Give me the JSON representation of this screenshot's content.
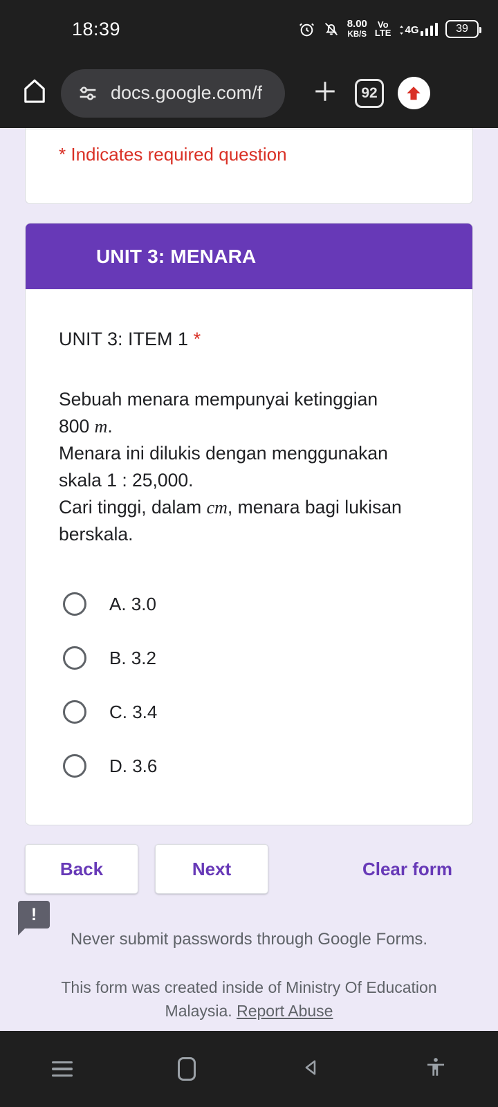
{
  "status_bar": {
    "time": "18:39",
    "icons": [
      "alarm-icon",
      "bell-off-icon"
    ],
    "data_rate": "8.00",
    "data_rate_unit": "KB/S",
    "voice": "Vo",
    "voice2": "LTE",
    "network": "4G",
    "battery_level": "39"
  },
  "browser": {
    "home_icon": "home-icon",
    "page_info_icon": "tune-icon",
    "url": "docs.google.com/f",
    "new_tab_icon": "plus-icon",
    "tab_count": "92",
    "update_icon": "upload-arrow-icon"
  },
  "form": {
    "required_note": "* Indicates required question",
    "section_title": "UNIT 3: MENARA",
    "question": {
      "title": "UNIT 3: ITEM 1",
      "required_marker": "*",
      "text_line1": "Sebuah menara mempunyai ketinggian",
      "text_800": "800",
      "unit_m": "m",
      "text_dot": ".",
      "text_line2": "Menara ini dilukis dengan menggunakan",
      "text_line3": "skala 1 : 25,000.",
      "text_line4a": "Cari tinggi, dalam",
      "unit_cm": "cm",
      "text_line4b": ", menara bagi lukisan",
      "text_line5": "berskala."
    },
    "options": [
      {
        "label": "A. 3.0",
        "selected": false
      },
      {
        "label": "B. 3.2",
        "selected": false
      },
      {
        "label": "C. 3.4",
        "selected": false
      },
      {
        "label": "D. 3.6",
        "selected": false
      }
    ],
    "buttons": {
      "back": "Back",
      "next": "Next",
      "clear": "Clear form"
    },
    "never_submit": "Never submit passwords through Google Forms.",
    "created_note": "This form was created inside of Ministry Of Education Malaysia.",
    "report_abuse": "Report Abuse",
    "feedback_badge": "!"
  },
  "navbar": {
    "recents": "recents-icon",
    "home": "home-square-icon",
    "back": "back-triangle-icon",
    "accessibility": "accessibility-icon"
  },
  "colors": {
    "accent_purple": "#6739b7",
    "page_bg": "#ede9f7",
    "required_red": "#d93025",
    "system_bar": "#1f1f1f"
  }
}
